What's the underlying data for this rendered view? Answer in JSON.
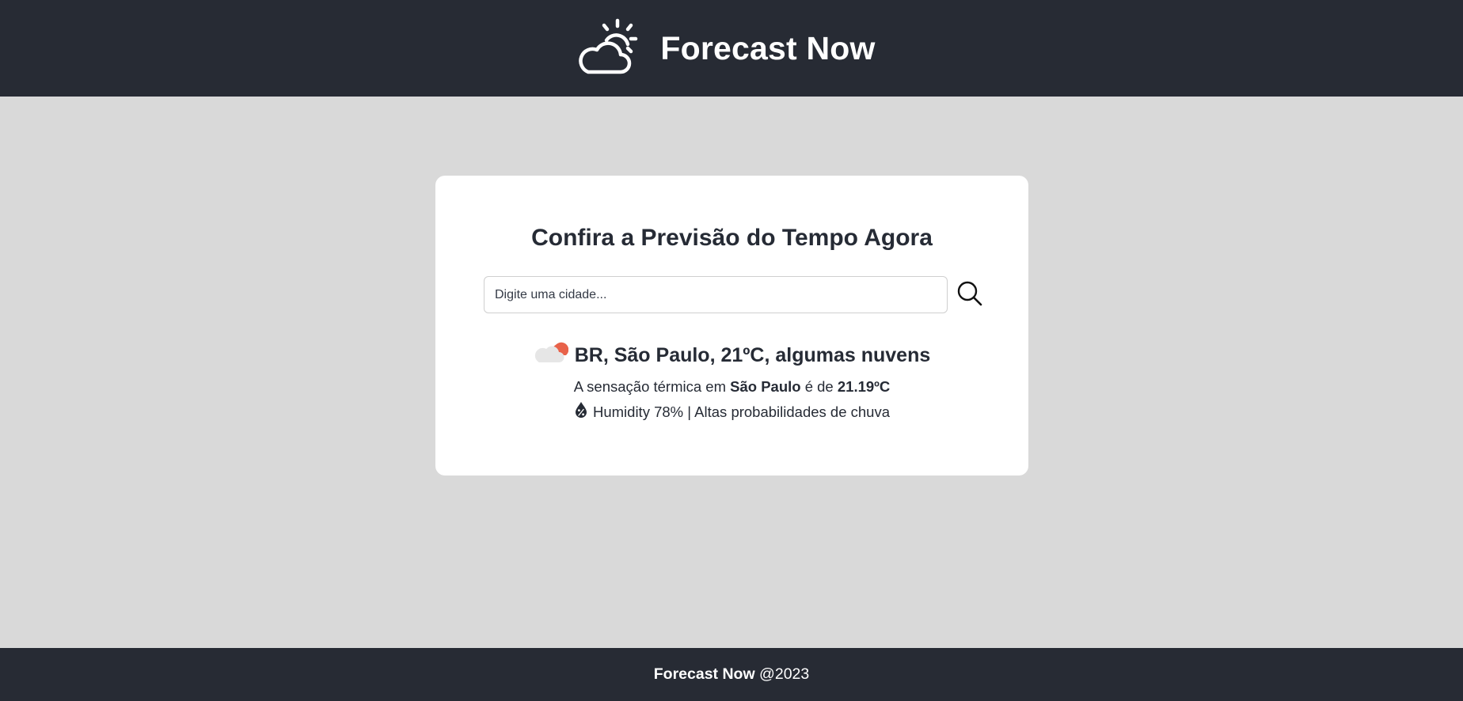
{
  "header": {
    "logo_icon": "partly-cloudy-icon",
    "title": "Forecast Now"
  },
  "card": {
    "title": "Confira a Previsão do Tempo Agora",
    "search": {
      "placeholder": "Digite uma cidade...",
      "value": "",
      "button_icon": "search-icon"
    },
    "result": {
      "weather_icon": "few-clouds-icon",
      "summary": "BR, São Paulo, 21ºC, algumas nuvens",
      "feels_prefix": "A sensação térmica em",
      "city": "São Paulo",
      "feels_middle": "é de",
      "feels_temp": "21.19ºC",
      "humidity_icon": "humidity-drop-icon",
      "humidity_text": "Humidity 78% | Altas probabilidades de chuva"
    }
  },
  "footer": {
    "brand": "Forecast Now",
    "suffix": " @2023"
  },
  "colors": {
    "bar": "#272b34",
    "background": "#d9d9d9",
    "card": "#ffffff",
    "text": "#262b35",
    "sun_accent": "#e8624a"
  }
}
